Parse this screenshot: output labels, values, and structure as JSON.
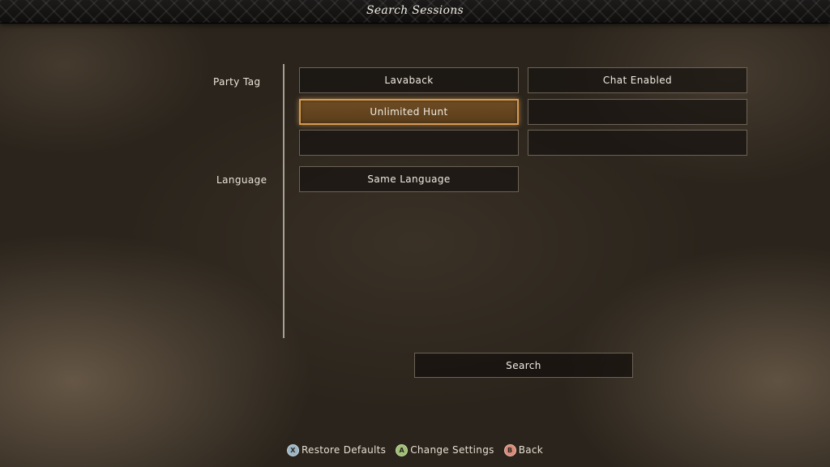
{
  "header": {
    "title": "Search Sessions"
  },
  "form": {
    "party_tag_label": "Party Tag",
    "language_label": "Language",
    "party_tags": [
      "Lavaback",
      "Chat Enabled",
      "Unlimited Hunt",
      "",
      "",
      ""
    ],
    "language_value": "Same Language",
    "search_label": "Search"
  },
  "footer": {
    "restore": {
      "glyph": "X",
      "label": "Restore Defaults"
    },
    "change": {
      "glyph": "A",
      "label": "Change Settings"
    },
    "back": {
      "glyph": "B",
      "label": "Back"
    }
  },
  "colors": {
    "selected_border": "#d69a52",
    "selected_fill": "#6e4d24"
  }
}
